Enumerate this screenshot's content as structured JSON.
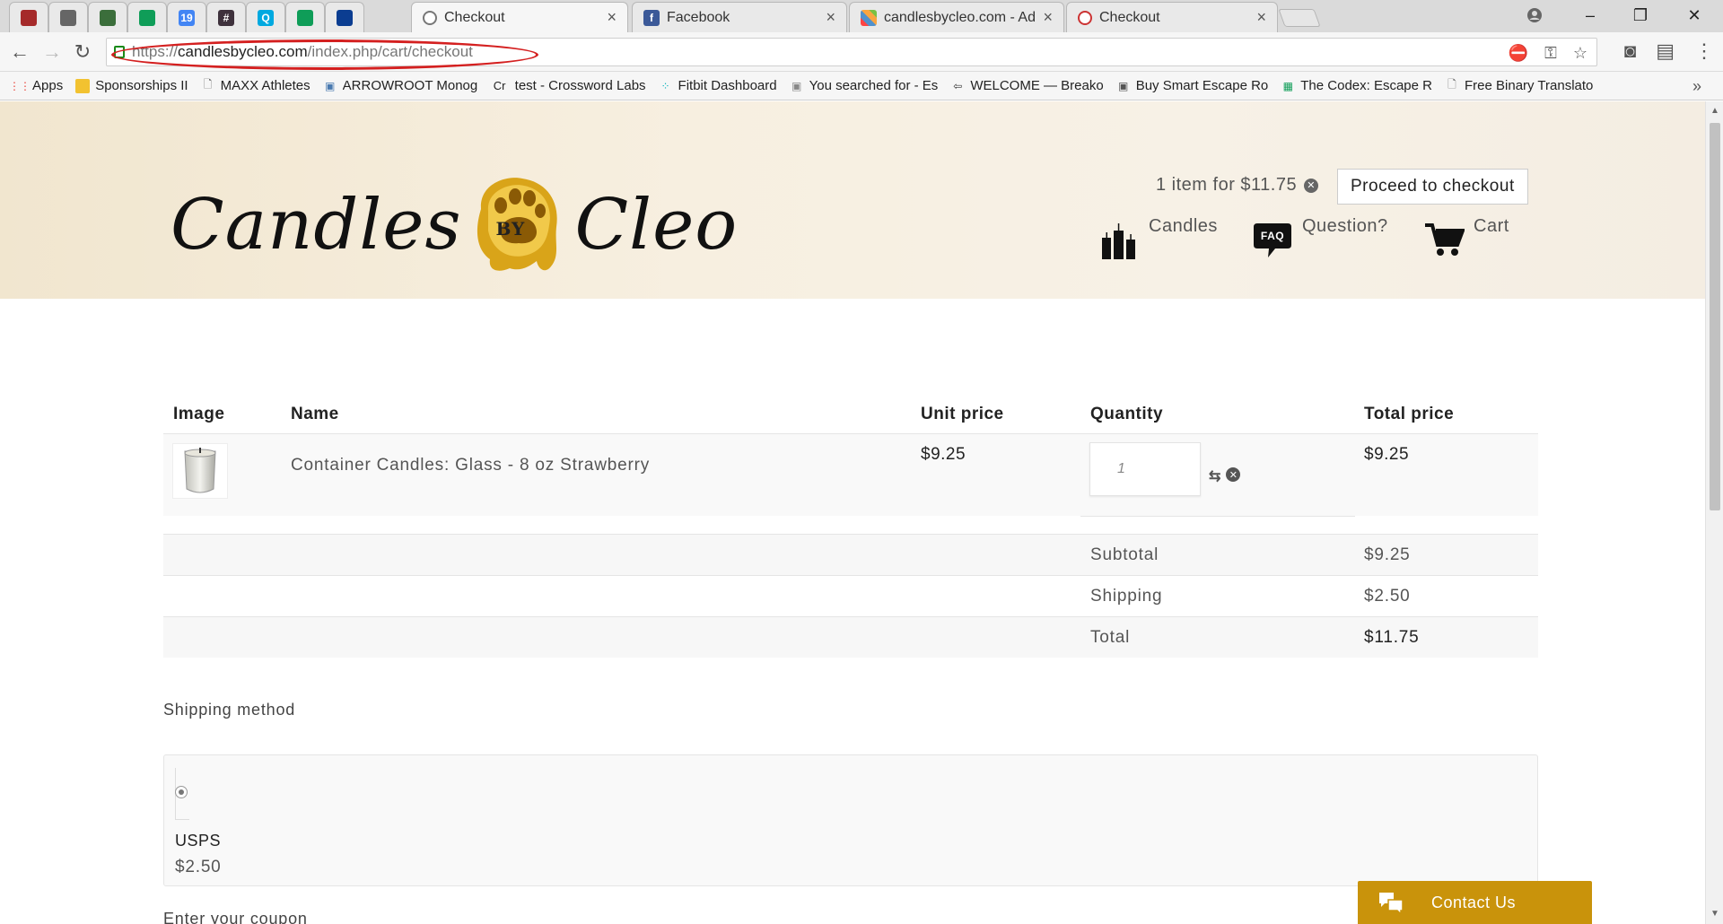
{
  "browser": {
    "pinned_tabs": [
      {
        "icon": "red-bars-icon",
        "color": "#a52a2a"
      },
      {
        "icon": "document-icon",
        "color": "#666666"
      },
      {
        "icon": "image-icon",
        "color": "#3b6e3b"
      },
      {
        "icon": "sheets-icon",
        "color": "#0f9d58"
      },
      {
        "icon": "calendar-icon",
        "color": "#4285f4",
        "text": "19"
      },
      {
        "icon": "slack-icon",
        "color": "#3e313c",
        "text": "#"
      },
      {
        "icon": "q-icon",
        "color": "#00a9e0",
        "text": "Q"
      },
      {
        "icon": "sheets-icon",
        "color": "#0f9d58"
      },
      {
        "icon": "nasa-icon",
        "color": "#0b3d91"
      }
    ],
    "tabs": [
      {
        "title": "Checkout",
        "icon": "web-icon",
        "active": true
      },
      {
        "title": "Facebook",
        "icon": "facebook-icon",
        "active": false
      },
      {
        "title": "candlesbycleo.com - Adm",
        "icon": "joomla-icon",
        "active": false
      },
      {
        "title": "Checkout",
        "icon": "web-icon",
        "active": false
      }
    ],
    "url_scheme": "https://",
    "url_host": "candlesbycleo.com",
    "url_path": "/index.php/cart/checkout",
    "bookmarks": [
      {
        "label": "Apps",
        "icon": "apps-icon"
      },
      {
        "label": "Sponsorships II",
        "icon": "folder-icon"
      },
      {
        "label": "MAXX Athletes",
        "icon": "page-icon"
      },
      {
        "label": "ARROWROOT Monog",
        "icon": "site-icon"
      },
      {
        "label": "test - Crossword Labs",
        "icon": "crossword-icon",
        "prefix": "Cr"
      },
      {
        "label": "Fitbit Dashboard",
        "icon": "fitbit-icon"
      },
      {
        "label": "You searched for - Es",
        "icon": "search-site-icon"
      },
      {
        "label": "WELCOME — Breako",
        "icon": "breakout-icon"
      },
      {
        "label": "Buy Smart Escape Ro",
        "icon": "lock-site-icon"
      },
      {
        "label": "The Codex: Escape R",
        "icon": "sheets-icon"
      },
      {
        "label": "Free Binary Translato",
        "icon": "page-icon"
      }
    ]
  },
  "site": {
    "logo_left": "Candles",
    "logo_by": "BY",
    "logo_right": "Cleo",
    "minicart_text": "1 item for $11.75",
    "proceed_label": "Proceed to checkout",
    "nav": [
      {
        "label": "Candles",
        "icon": "candles-icon"
      },
      {
        "label": "Question?",
        "icon": "faq-icon"
      },
      {
        "label": "Cart",
        "icon": "cart-icon"
      }
    ],
    "faq_badge": "FAQ"
  },
  "cart": {
    "headers": {
      "image": "Image",
      "name": "Name",
      "unit_price": "Unit price",
      "quantity": "Quantity",
      "total_price": "Total price"
    },
    "item": {
      "name": "Container Candles: Glass - 8 oz Strawberry",
      "unit_price": "$9.25",
      "quantity": "1",
      "total_price": "$9.25"
    },
    "totals": [
      {
        "label": "Subtotal",
        "value": "$9.25"
      },
      {
        "label": "Shipping",
        "value": "$2.50"
      },
      {
        "label": "Total",
        "value": "$11.75"
      }
    ]
  },
  "shipping": {
    "title": "Shipping method",
    "carrier": "USPS",
    "cost": "$2.50"
  },
  "coupon_title": "Enter your coupon",
  "contact_label": "Contact Us",
  "colors": {
    "accent": "#c9930b",
    "annotation": "#d42020"
  }
}
